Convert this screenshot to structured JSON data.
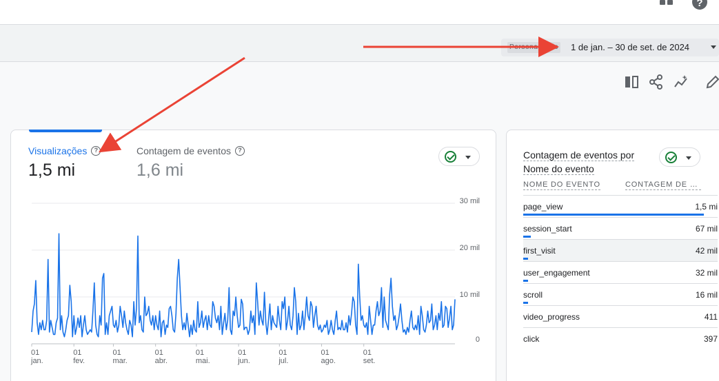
{
  "date_range": {
    "chip": "Personalizado",
    "label": "1 de jan. – 30 de set. de 2024"
  },
  "toolbar": {
    "icons": [
      "compare-columns-icon",
      "share-icon",
      "insights-icon",
      "edit-icon"
    ]
  },
  "metrics": [
    {
      "label": "Visualizações",
      "value": "1,5 mi",
      "active": true
    },
    {
      "label": "Contagem de eventos",
      "value": "1,6 mi",
      "active": false
    }
  ],
  "colors": {
    "accent": "#1a73e8",
    "arrow": "#ea4335",
    "ok": "#188038"
  },
  "chart_data": {
    "type": "line",
    "series": [
      {
        "values": [
          2.5,
          7,
          8.5,
          13.5,
          4.5,
          2,
          4.5,
          3,
          5,
          3,
          3,
          5,
          18,
          2.5,
          5,
          3.5,
          2,
          2,
          4.5,
          5.5,
          23.5,
          3,
          6,
          2.5,
          1.5,
          3,
          5,
          6,
          12.5,
          9,
          1.5,
          6,
          2,
          3.5,
          5.5,
          3.5,
          6,
          1.5,
          4,
          6,
          3,
          2,
          2.5,
          3,
          2.5,
          7,
          13,
          4,
          2,
          1.5,
          6,
          4,
          14,
          15,
          2,
          4.5,
          2,
          6,
          7,
          8,
          4,
          3.5,
          5,
          2.5,
          4,
          8,
          6,
          3.5,
          7,
          4.5,
          3,
          2,
          5,
          4,
          1.5,
          9,
          4,
          7.5,
          23,
          4.5,
          6,
          3,
          2.5,
          10,
          6,
          6.5,
          8,
          5,
          4,
          6,
          3,
          6,
          4,
          3,
          7,
          1.5,
          4.5,
          5,
          2,
          4,
          3.5,
          7.5,
          8,
          6,
          3,
          2.5,
          6.5,
          14,
          18,
          12,
          6,
          3,
          4.5,
          3,
          6.5,
          4,
          1.5,
          4,
          2,
          5,
          3,
          2.5,
          9,
          3.5,
          4.5,
          7,
          3.5,
          5,
          6,
          3,
          6,
          4,
          3.5,
          9,
          8,
          5.5,
          4.5,
          6,
          3,
          8,
          2,
          4.5,
          6.5,
          3,
          5,
          12,
          3,
          2,
          7,
          6,
          10,
          6,
          3.5,
          4,
          9.5,
          8.5,
          3,
          3.5,
          3.5,
          2,
          3,
          7,
          4.5,
          6,
          2,
          13,
          9,
          4,
          7,
          5,
          4,
          11,
          4.5,
          2,
          5,
          8.5,
          3,
          6,
          4.5,
          4,
          3.5,
          8,
          5,
          3,
          9,
          7.5,
          10,
          3,
          5,
          8,
          4,
          3,
          6,
          12,
          9,
          2,
          6.5,
          3,
          4,
          7,
          3,
          6,
          10,
          6,
          5,
          9,
          8,
          3.5,
          6,
          8,
          4,
          3,
          4,
          2.5,
          3,
          4,
          3.5,
          5,
          2,
          3,
          5,
          3,
          2,
          5,
          7,
          3,
          3.5,
          3,
          5,
          3,
          3,
          4.5,
          2.5,
          6,
          4,
          6.5,
          10,
          9,
          4,
          2,
          17,
          10,
          5,
          6,
          4,
          3.5,
          4.5,
          2,
          8,
          5,
          2,
          4,
          4,
          7,
          9,
          6,
          7,
          12,
          3.5,
          10,
          5,
          4,
          3,
          10.5,
          14,
          8,
          5,
          6,
          3,
          4,
          6,
          8.5,
          5,
          2.5,
          3,
          2,
          3.5,
          2.5,
          5,
          7,
          3.5,
          3,
          4,
          3,
          6,
          2,
          8,
          6,
          3,
          2.5,
          4,
          7,
          4.5,
          5,
          8.5,
          3,
          4,
          6,
          3,
          6.5,
          5,
          9,
          3.5,
          4,
          8,
          7.5,
          3.5,
          5.5,
          8,
          3,
          4,
          9.5
        ]
      }
    ],
    "x_tick_labels": [
      {
        "day": "01",
        "month": "jan.",
        "index": 0
      },
      {
        "day": "01",
        "month": "fev.",
        "index": 31
      },
      {
        "day": "01",
        "month": "mar.",
        "index": 60
      },
      {
        "day": "01",
        "month": "abr.",
        "index": 91
      },
      {
        "day": "01",
        "month": "mai.",
        "index": 121
      },
      {
        "day": "01",
        "month": "jun.",
        "index": 152
      },
      {
        "day": "01",
        "month": "jul.",
        "index": 182
      },
      {
        "day": "01",
        "month": "ago.",
        "index": 213
      },
      {
        "day": "01",
        "month": "set.",
        "index": 244
      }
    ],
    "y_tick_labels": [
      {
        "value": 30,
        "label": "30 mil"
      },
      {
        "value": 20,
        "label": "20 mil"
      },
      {
        "value": 10,
        "label": "10 mil"
      },
      {
        "value": 0,
        "label": "0"
      }
    ],
    "ylim": [
      0,
      30
    ],
    "grid": true
  },
  "events_card": {
    "title_line1": "Contagem de eventos por",
    "title_line2": "Nome do evento",
    "col_name": "NOME DO EVENTO",
    "col_value": "CONTAGEM DE EVENTOS",
    "rows": [
      {
        "name": "page_view",
        "value": "1,5 mi",
        "share": 0.93
      },
      {
        "name": "session_start",
        "value": "67 mil",
        "share": 0.04
      },
      {
        "name": "first_visit",
        "value": "42 mil",
        "share": 0.026
      },
      {
        "name": "user_engagement",
        "value": "32 mil",
        "share": 0.02
      },
      {
        "name": "scroll",
        "value": "16 mil",
        "share": 0.01
      },
      {
        "name": "video_progress",
        "value": "411",
        "share": 0
      },
      {
        "name": "click",
        "value": "397",
        "share": 0
      }
    ]
  }
}
